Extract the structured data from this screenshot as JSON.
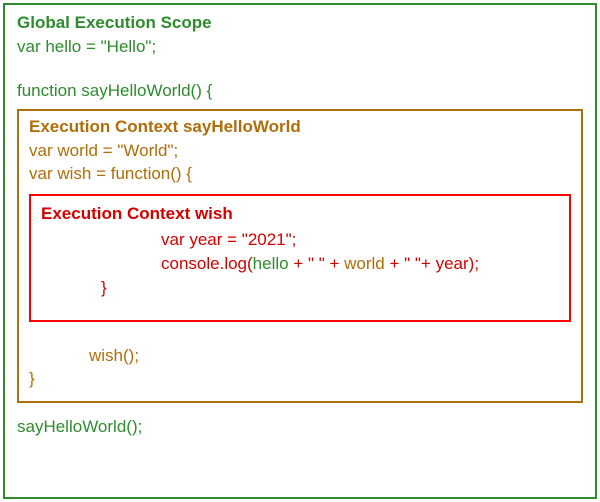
{
  "global": {
    "title": "Global Execution Scope",
    "line1": "var hello = \"Hello\";",
    "line2": "function sayHelloWorld() {",
    "call": "sayHelloWorld();"
  },
  "mid": {
    "title": "Execution Context  sayHelloWorld",
    "line1": "var world = \"World\";",
    "line2": "var wish = function() {",
    "wishcall": "wish();",
    "closebrace": "}"
  },
  "inner": {
    "title": "Execution Context wish",
    "line1": "var year = \"2021\";",
    "log_prefix": "console.log(",
    "hello": "hello",
    "plus1": " + \" \" + ",
    "world": "world",
    "plus2": " + \" \"+ ",
    "year": "year",
    "log_suffix": ");",
    "closebrace": "}"
  }
}
